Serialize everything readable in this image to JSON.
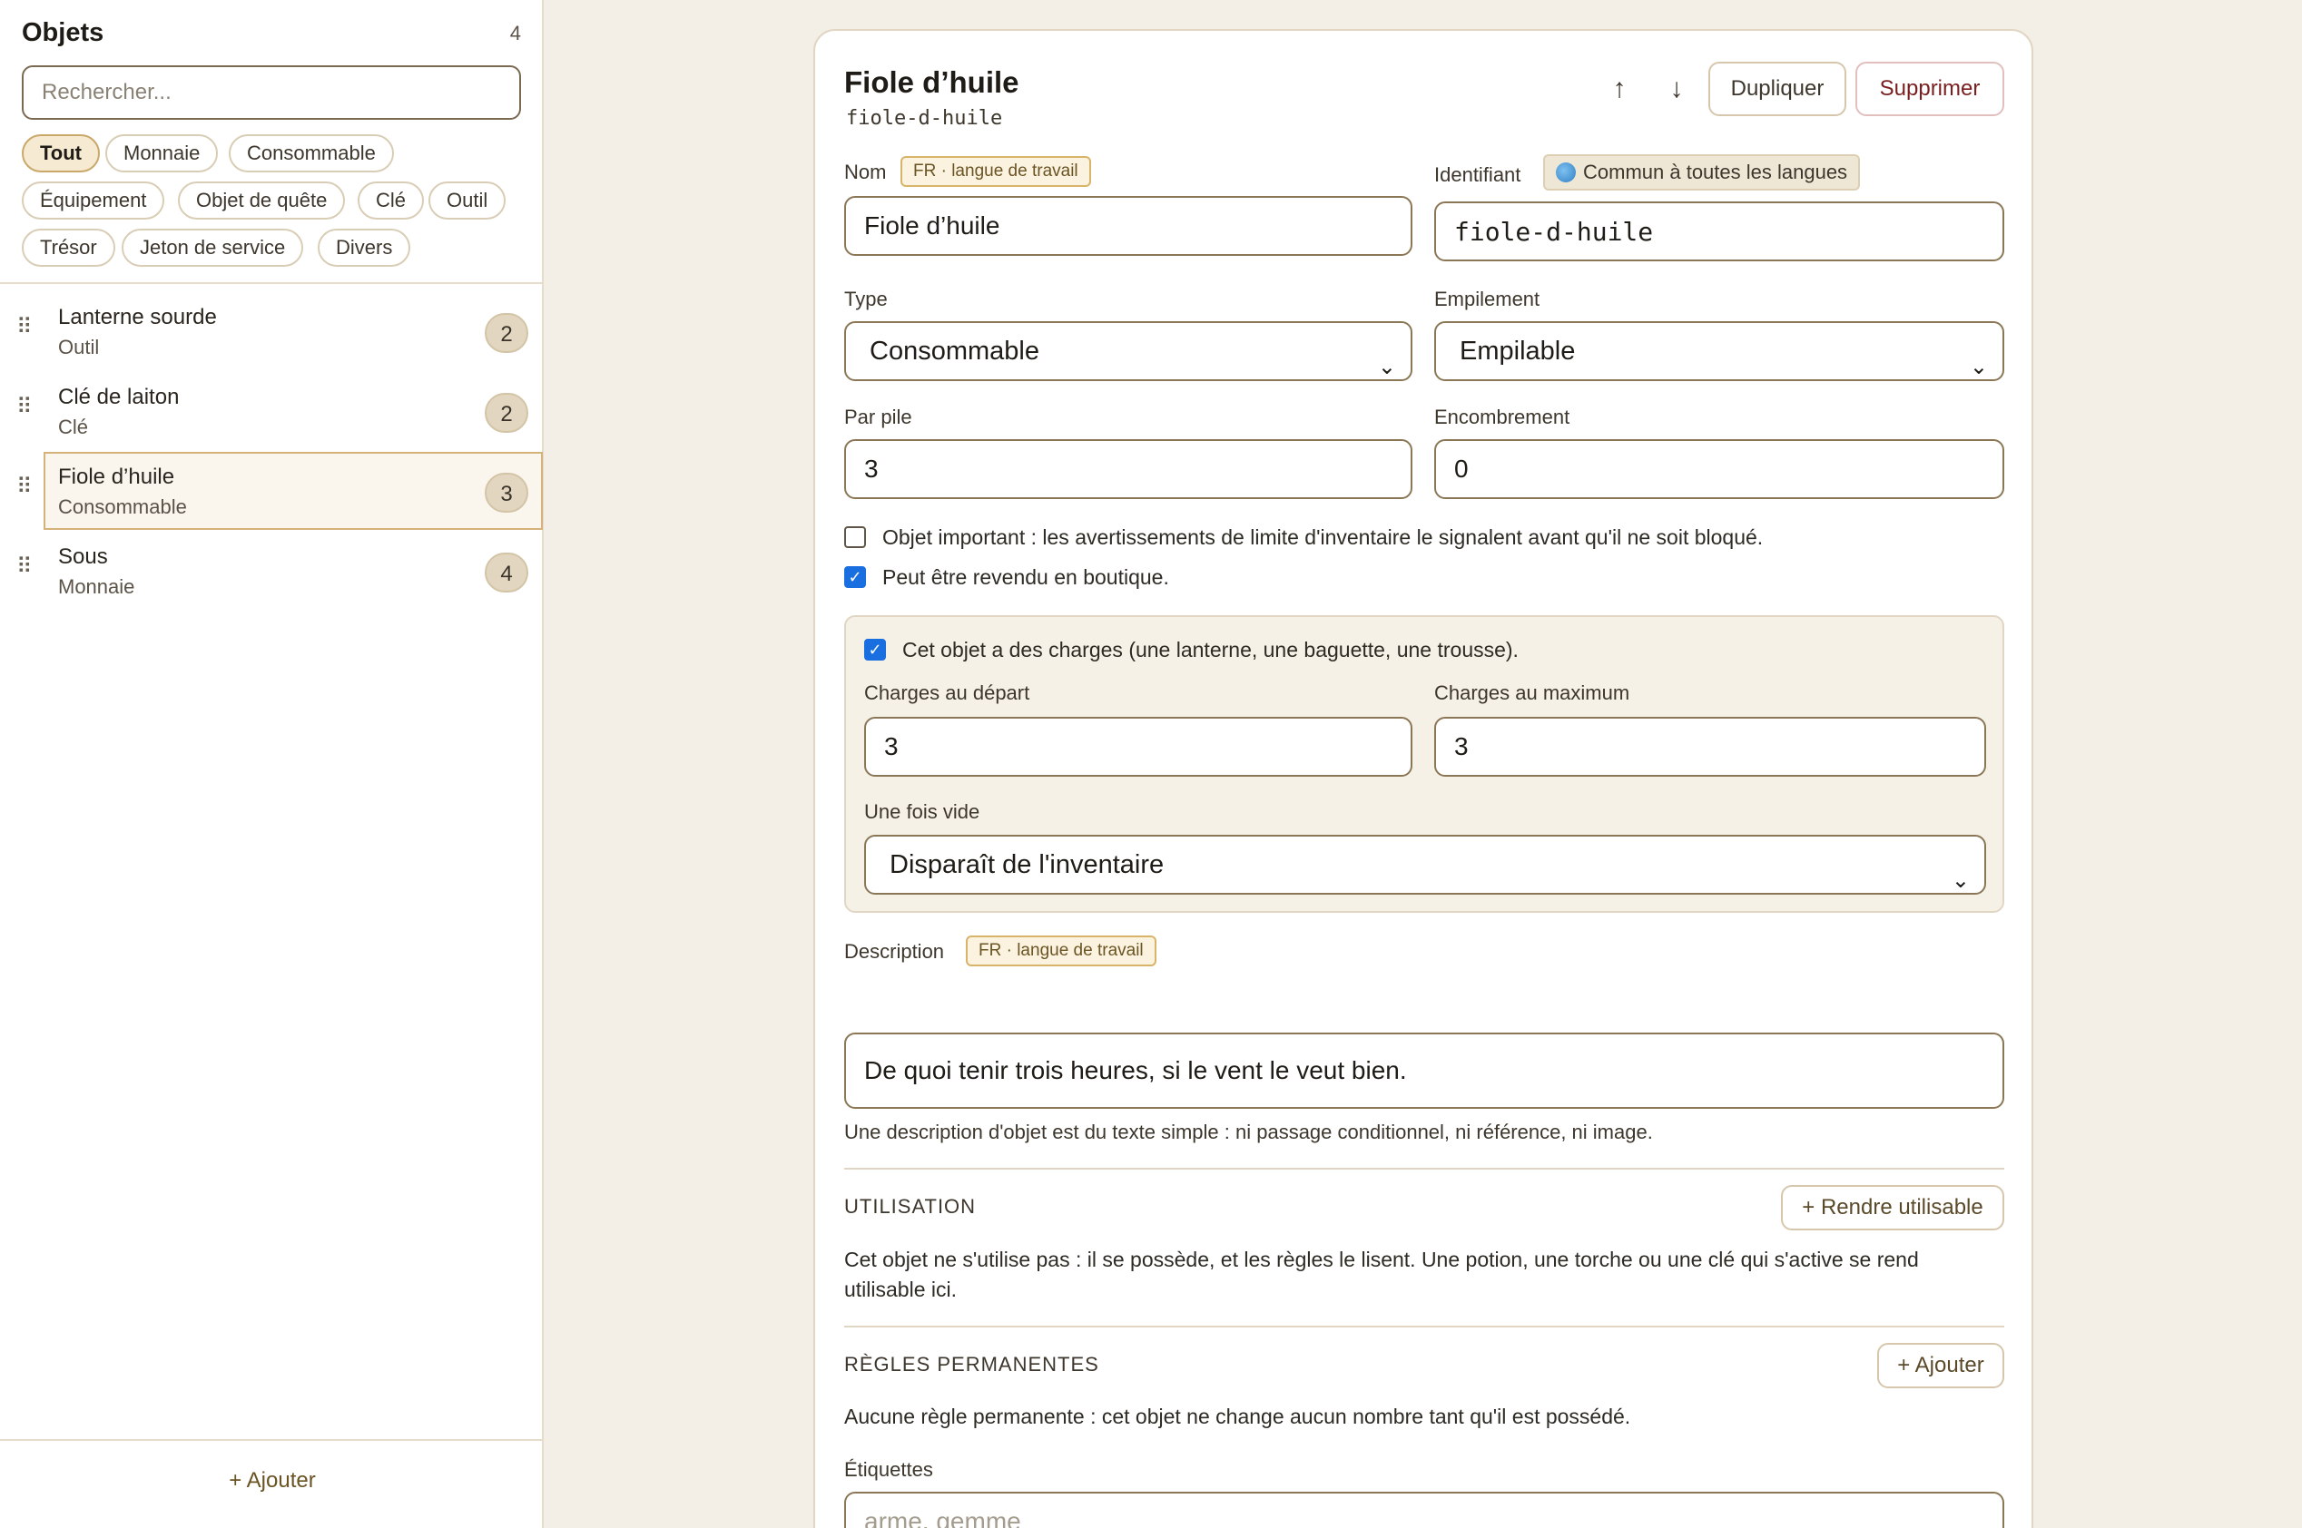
{
  "sidebar": {
    "title": "Objets",
    "count": "4",
    "search_placeholder": "Rechercher...",
    "filters": [
      {
        "label": "Tout",
        "active": true
      },
      {
        "label": "Monnaie"
      },
      {
        "label": "Consommable"
      },
      {
        "label": "Équipement"
      },
      {
        "label": "Objet de quête"
      },
      {
        "label": "Clé"
      },
      {
        "label": "Outil"
      },
      {
        "label": "Trésor"
      },
      {
        "label": "Jeton de service"
      },
      {
        "label": "Divers"
      }
    ],
    "items": [
      {
        "name": "Lanterne sourde",
        "type": "Outil",
        "badge": "2"
      },
      {
        "name": "Clé de laiton",
        "type": "Clé",
        "badge": "2"
      },
      {
        "name": "Fiole d’huile",
        "type": "Consommable",
        "badge": "3",
        "selected": true
      },
      {
        "name": "Sous",
        "type": "Monnaie",
        "badge": "4"
      }
    ],
    "add_label": "+ Ajouter"
  },
  "editor": {
    "title": "Fiole d’huile",
    "slug": "fiole-d-huile",
    "move_up_icon": "arrow-up-icon",
    "move_down_icon": "arrow-down-icon",
    "duplicate_label": "Dupliquer",
    "delete_label": "Supprimer",
    "name_label": "Nom",
    "lang_tag": "FR · langue de travail",
    "name_value": "Fiole d’huile",
    "id_label": "Identifiant",
    "id_tag": "Commun à toutes les langues",
    "id_value": "fiole-d-huile",
    "type_label": "Type",
    "type_value": "Consommable",
    "stack_label": "Empilement",
    "stack_value": "Empilable",
    "per_stack_label": "Par pile",
    "per_stack_value": "3",
    "encumbrance_label": "Encombrement",
    "encumbrance_value": "0",
    "important_label": "Objet important : les avertissements de limite d'inventaire le signalent avant qu'il ne soit bloqué.",
    "important_checked": false,
    "resell_label": "Peut être revendu en boutique.",
    "resell_checked": true,
    "charges": {
      "enabled_label": "Cet objet a des charges (une lanterne, une baguette, une trousse).",
      "enabled": true,
      "start_label": "Charges au départ",
      "start_value": "3",
      "max_label": "Charges au maximum",
      "max_value": "3",
      "empty_label": "Une fois vide",
      "empty_value": "Disparaît de l'inventaire"
    },
    "description_label": "Description",
    "description_value": "De quoi tenir trois heures, si le vent le veut bien.",
    "description_hint": "Une description d'objet est du texte simple : ni passage conditionnel, ni référence, ni image.",
    "usage_title": "UTILISATION",
    "usage_button": "+ Rendre utilisable",
    "usage_text": "Cet objet ne s'utilise pas : il se possède, et les règles le lisent. Une potion, une torche ou une clé qui s'active se rend utilisable ici.",
    "rules_title": "RÈGLES PERMANENTES",
    "rules_button": "+ Ajouter",
    "rules_text": "Aucune règle permanente : cet objet ne change aucun nombre tant qu'il est possédé.",
    "tags_label": "Étiquettes",
    "tags_placeholder": "arme, gemme"
  },
  "colors": {
    "background": "#f3efe6",
    "accent": "#c9a86a",
    "danger": "#7a1f1f",
    "checkbox": "#1a6fe0"
  }
}
